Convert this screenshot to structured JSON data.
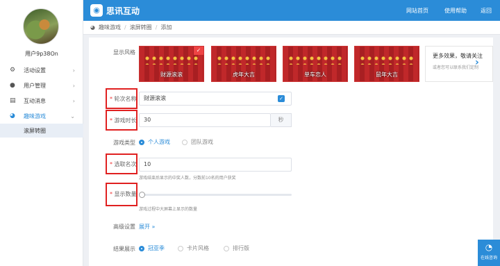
{
  "app": {
    "title": "思讯互动"
  },
  "topnav": {
    "home": "网站首页",
    "help": "使用帮助",
    "back": "返回"
  },
  "user": {
    "name": "用户9p38On"
  },
  "sidebar": {
    "items": [
      {
        "label": "活动设置",
        "icon": "gear-icon"
      },
      {
        "label": "用户管理",
        "icon": "user-icon"
      },
      {
        "label": "互动消息",
        "icon": "message-icon"
      },
      {
        "label": "趣味游戏",
        "icon": "game-icon"
      }
    ],
    "sub_item": "滚屏转圈"
  },
  "breadcrumb": [
    "趣味游戏",
    "滚屏转圈",
    "添加"
  ],
  "form": {
    "style_label": "显示风格",
    "styles": [
      "财源滚滚",
      "虎年大吉",
      "单车恋人",
      "鼠年大吉"
    ],
    "more_title": "更多效果，敬请关注",
    "more_desc": "或者您可以联系我们定制",
    "round_name_label": "轮次名称",
    "round_name_value": "财源滚滚",
    "duration_label": "游戏时长",
    "duration_value": "30",
    "duration_unit": "秒",
    "game_type_label": "游戏类型",
    "game_type_options": [
      "个人游戏",
      "团队游戏"
    ],
    "select_rank_label": "选取名次",
    "select_rank_value": "10",
    "select_rank_hint": "游戏结束后显示的中奖人数，分数前10名的用户获奖",
    "display_count_label": "显示数量",
    "display_count_hint": "游戏过程中大屏幕上显示的数量",
    "display_count_level": 0,
    "advanced_label": "高级设置",
    "advanced_link": "展开 »",
    "result_label": "结果展示",
    "result_options": [
      "冠亚季",
      "卡片风格",
      "排行版"
    ]
  },
  "help_button": {
    "label": "在线咨询"
  },
  "colors": {
    "primary": "#2b8cd8",
    "highlight_box": "#e02020"
  }
}
